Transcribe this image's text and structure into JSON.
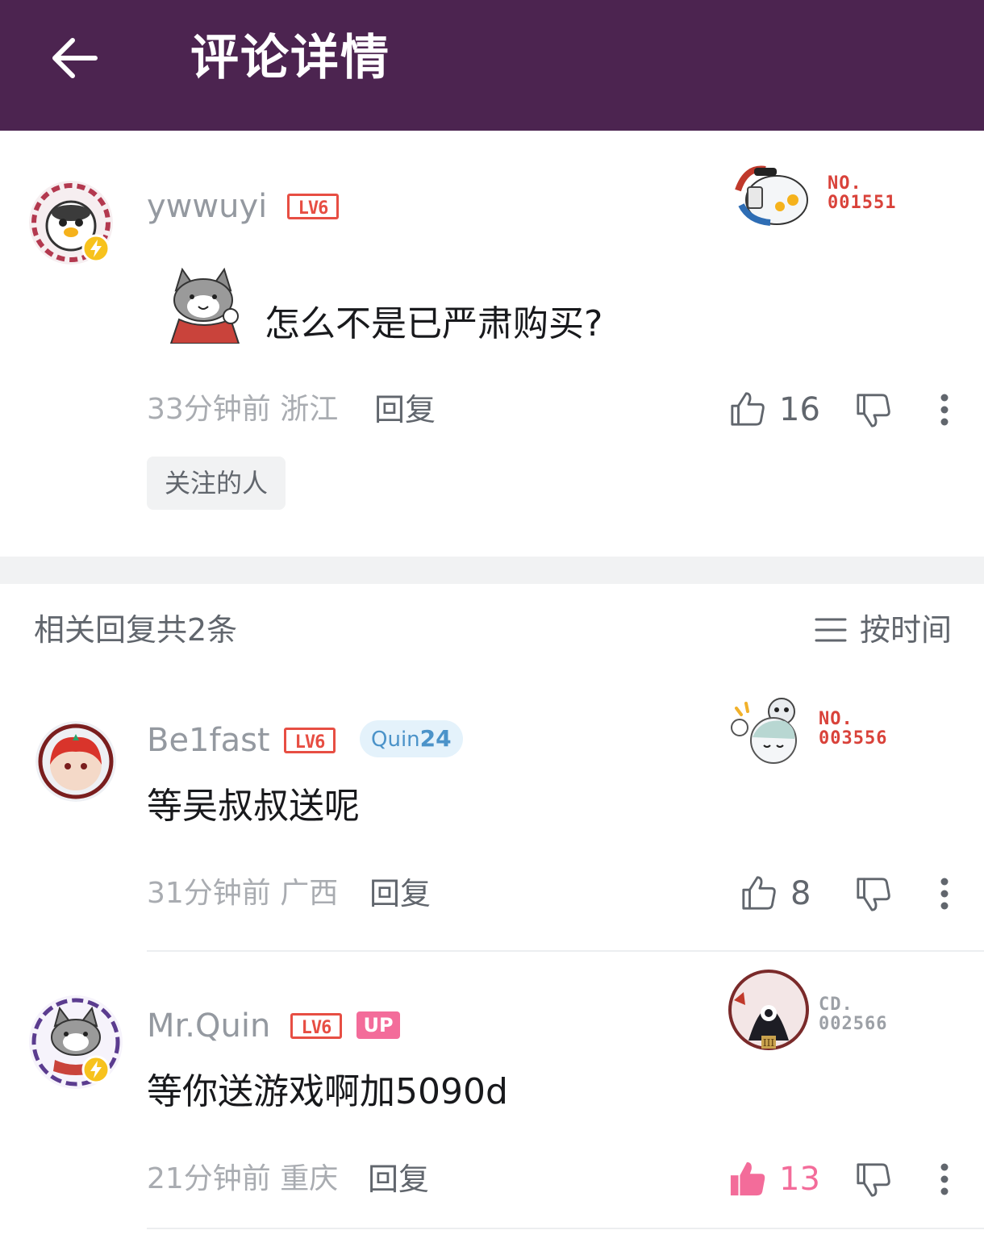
{
  "header": {
    "title": "评论详情"
  },
  "main_comment": {
    "username": "ywwuyi",
    "level": "LV6",
    "fan_card": {
      "label": "NO.",
      "number": "001551"
    },
    "text": "怎么不是已严肃购买?",
    "time_location": "33分钟前  浙江",
    "reply_label": "回复",
    "likes": "16",
    "tag": "关注的人"
  },
  "replies_section": {
    "title": "相关回复共2条",
    "sort_label": "按时间"
  },
  "replies": [
    {
      "username": "Be1fast",
      "level": "LV6",
      "badge_prefix": "Quin",
      "badge_number": "24",
      "fan_card": {
        "label": "NO.",
        "number": "003556"
      },
      "text": "等吴叔叔送呢",
      "time_location": "31分钟前  广西",
      "reply_label": "回复",
      "likes": "8"
    },
    {
      "username": "Mr.Quin",
      "level": "LV6",
      "up_badge": "UP",
      "fan_card": {
        "label": "CD.",
        "number": "002566"
      },
      "text": "等你送游戏啊加5090d",
      "time_location": "21分钟前  重庆",
      "reply_label": "回复",
      "likes": "13",
      "liked": true
    }
  ],
  "colors": {
    "header_bg": "#4c2450",
    "level_red": "#e74e43",
    "up_pink": "#f36c9a",
    "liked_pink": "#f36c9a"
  }
}
